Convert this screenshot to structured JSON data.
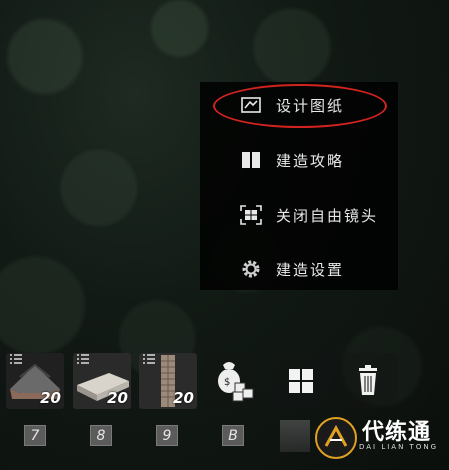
{
  "menu": {
    "items": [
      {
        "label": "设计图纸",
        "icon": "blueprint-icon"
      },
      {
        "label": "建造攻略",
        "icon": "book-icon"
      },
      {
        "label": "关闭自由镜头",
        "icon": "camera-frame-icon"
      },
      {
        "label": "建造设置",
        "icon": "gear-icon"
      }
    ]
  },
  "hotbar": {
    "slots": [
      {
        "icon": "roof-piece-icon",
        "count": "20",
        "key": "7"
      },
      {
        "icon": "floor-slab-icon",
        "count": "20",
        "key": "8"
      },
      {
        "icon": "wall-panel-icon",
        "count": "20",
        "key": "9"
      },
      {
        "icon": "materials-bag-icon",
        "count": "",
        "key": "B"
      },
      {
        "icon": "grid-layout-icon",
        "count": "",
        "key": ""
      },
      {
        "icon": "trash-icon",
        "count": "",
        "key": ""
      }
    ]
  },
  "watermark": {
    "name": "代练通",
    "sub": "DAI LIAN TONG"
  },
  "colors": {
    "highlight": "#d2231f",
    "menu_bg": "#000000",
    "text": "#e8e8e8"
  }
}
